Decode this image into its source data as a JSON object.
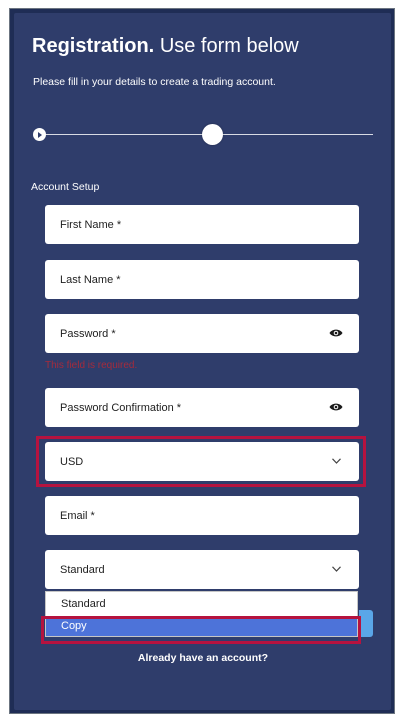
{
  "header": {
    "title_bold": "Registration.",
    "title_rest": "Use form below",
    "subtitle": "Please fill in your details to create a trading account."
  },
  "progress": {
    "step_icon": "play-icon"
  },
  "section": {
    "label": "Account Setup"
  },
  "form": {
    "first_name_placeholder": "First Name  *",
    "last_name_placeholder": "Last Name  *",
    "password_placeholder": "Password  *",
    "password_error": "This field is required.",
    "password_confirm_placeholder": "Password Confirmation  *",
    "currency_value": "USD",
    "email_placeholder": "Email  *",
    "account_type_value": "Standard"
  },
  "dropdown": {
    "options": [
      "Standard",
      "Copy"
    ],
    "selected_index": 1
  },
  "footer": {
    "login_link": "Already have an account?"
  },
  "colors": {
    "background": "#2f3d6b",
    "error": "#a52b3c",
    "highlight": "#b5133f",
    "selected_option": "#4d73d9"
  },
  "icons": {
    "eye": "eye-icon",
    "chevron": "chevron-down-icon"
  }
}
